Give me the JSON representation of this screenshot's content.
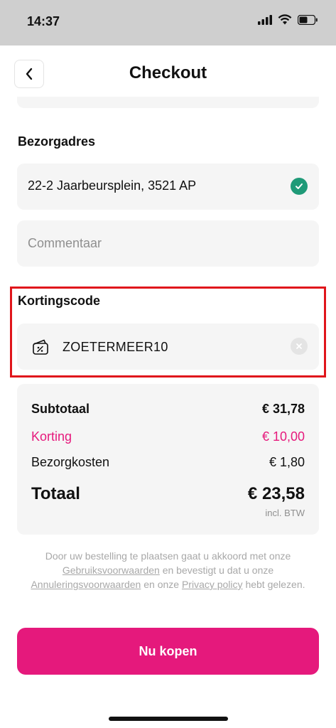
{
  "status_bar": {
    "time": "14:37",
    "battery_percent": 55
  },
  "header": {
    "title": "Checkout",
    "back_icon": "chevron-left-icon"
  },
  "delivery": {
    "label": "Bezorgadres",
    "address": "22-2 Jaarbeursplein, 3521 AP",
    "address_valid_icon": "check-circle-icon",
    "comment_placeholder": "Commentaar"
  },
  "discount": {
    "label": "Kortingscode",
    "code": "ZOETERMEER10",
    "icon": "coupon-icon",
    "clear_icon": "close-circle-icon"
  },
  "summary": {
    "subtotal_label": "Subtotaal",
    "subtotal_value": "€ 31,78",
    "discount_label": "Korting",
    "discount_value": "€ 10,00",
    "delivery_label": "Bezorgkosten",
    "delivery_value": "€ 1,80",
    "total_label": "Totaal",
    "total_value": "€ 23,58",
    "vat_note": "incl. BTW"
  },
  "legal": {
    "text_1": "Door uw bestelling te plaatsen gaat u akkoord met onze",
    "link_terms": "Gebruiksvoorwaarden",
    "text_2": "en bevestigt u dat u onze",
    "link_cancel": "Annuleringsvoorwaarden",
    "text_3": "en onze",
    "link_privacy": "Privacy policy",
    "text_4": "hebt gelezen."
  },
  "actions": {
    "buy_label": "Nu kopen"
  },
  "colors": {
    "accent": "#e5197c",
    "success": "#1f9a78",
    "highlight": "#e0151b"
  }
}
